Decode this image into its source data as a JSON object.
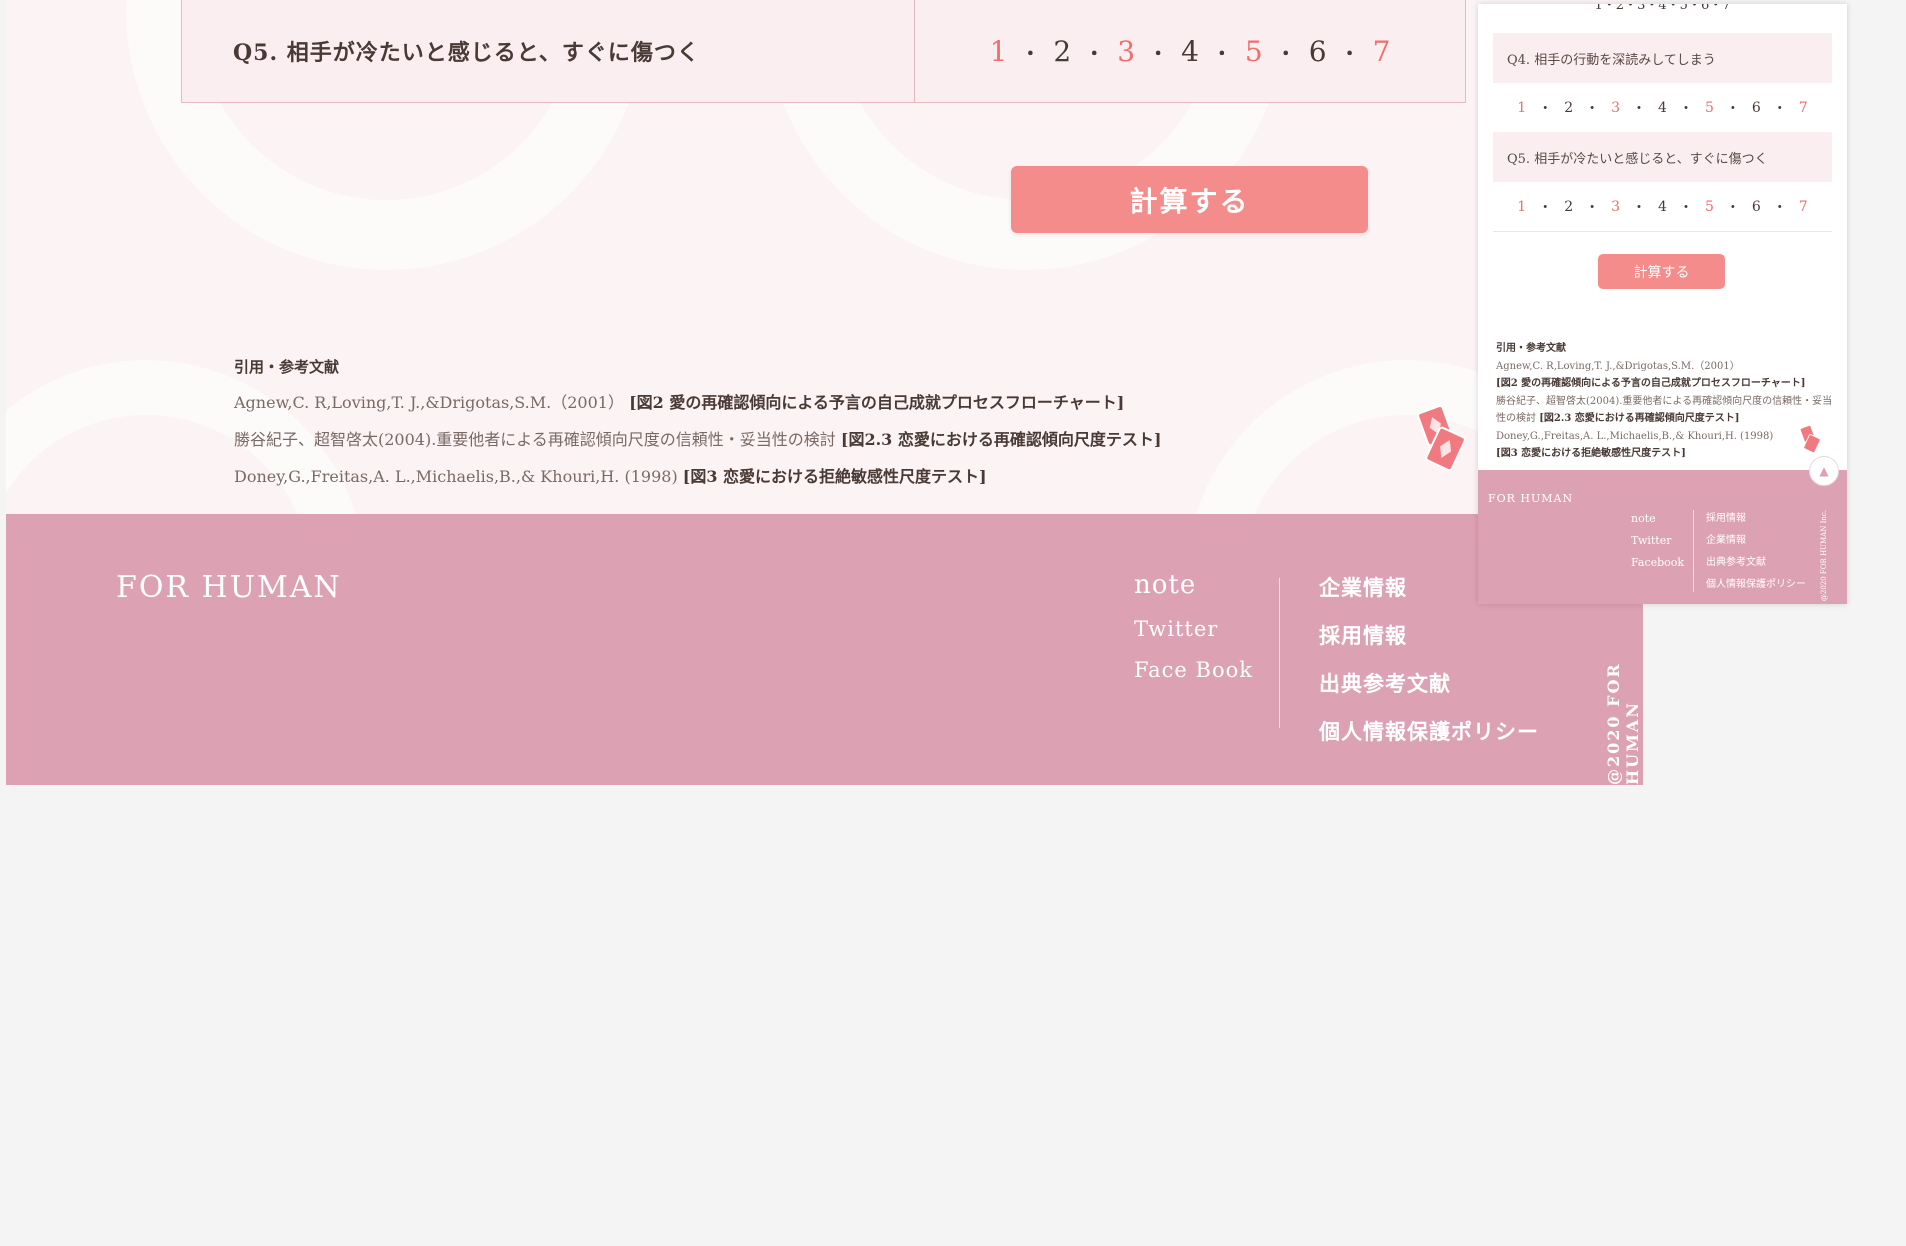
{
  "question": {
    "label": "Q5. 相手が冷たいと感じると、すぐに傷つく",
    "scale": [
      "1",
      "2",
      "3",
      "4",
      "5",
      "6",
      "7"
    ],
    "separator": "・"
  },
  "calc_button": "計算する",
  "references": {
    "title": "引用・参考文献",
    "items": [
      {
        "text": "Agnew,C. R,Loving,T. J.,&Drigotas,S.M.（2001）",
        "figure": "[図2 愛の再確認傾向による予言の自己成就プロセスフローチャート]"
      },
      {
        "text": "勝谷紀子、超智啓太(2004).重要他者による再確認傾向尺度の信頼性・妥当性の検討",
        "figure": "[図2.3 恋愛における再確認傾向尺度テスト]"
      },
      {
        "text": "Doney,G.,Freitas,A. L.,Michaelis,B.,& Khouri,H. (1998)",
        "figure": "[図3 恋愛における拒絶敏感性尺度テスト]"
      }
    ]
  },
  "footer": {
    "logo": "FOR HUMAN",
    "col1": [
      "note",
      "Twitter",
      "Face Book"
    ],
    "col2": [
      "企業情報",
      "採用情報",
      "出典参考文献",
      "個人情報保護ポリシー"
    ],
    "copyright": "@2020 FOR HUMAN"
  },
  "mobile": {
    "q4": "Q4. 相手の行動を深読みしてしまう",
    "q5": "Q5. 相手が冷たいと感じると、すぐに傷つく",
    "scale": [
      "1",
      "2",
      "3",
      "4",
      "5",
      "6",
      "7"
    ],
    "calc_button": "計算する",
    "refs_title": "引用・参考文献",
    "ref1_text": "Agnew,C. R,Loving,T. J.,&Drigotas,S.M.（2001）",
    "ref1_fig": "[図2 愛の再確認傾向による予言の自己成就プロセスフローチャート]",
    "ref2_text": "勝谷紀子、超智啓太(2004).重要他者による再確認傾向尺度の信頼性・妥当性の検討",
    "ref2_fig": "[図2.3 恋愛における再確認傾向尺度テスト]",
    "ref3_text": "Doney,G.,Freitas,A. L.,Michaelis,B.,& Khouri,H. (1998)",
    "ref3_fig": "[図3 恋愛における拒絶敏感性尺度テスト]",
    "footer_logo": "FOR HUMAN",
    "footer_col1": [
      "note",
      "Twitter",
      "Facebook"
    ],
    "footer_col2": [
      "採用情報",
      "企業情報",
      "出典参考文献",
      "個人情報保護ポリシー"
    ],
    "copyright": "@2020 FOR HUMAN Inc.",
    "top_icon": "arrow-up-icon"
  },
  "colors": {
    "accent": "#f48c8c",
    "footer": "#dca2b4",
    "odd_number": "#ef6e6e"
  }
}
